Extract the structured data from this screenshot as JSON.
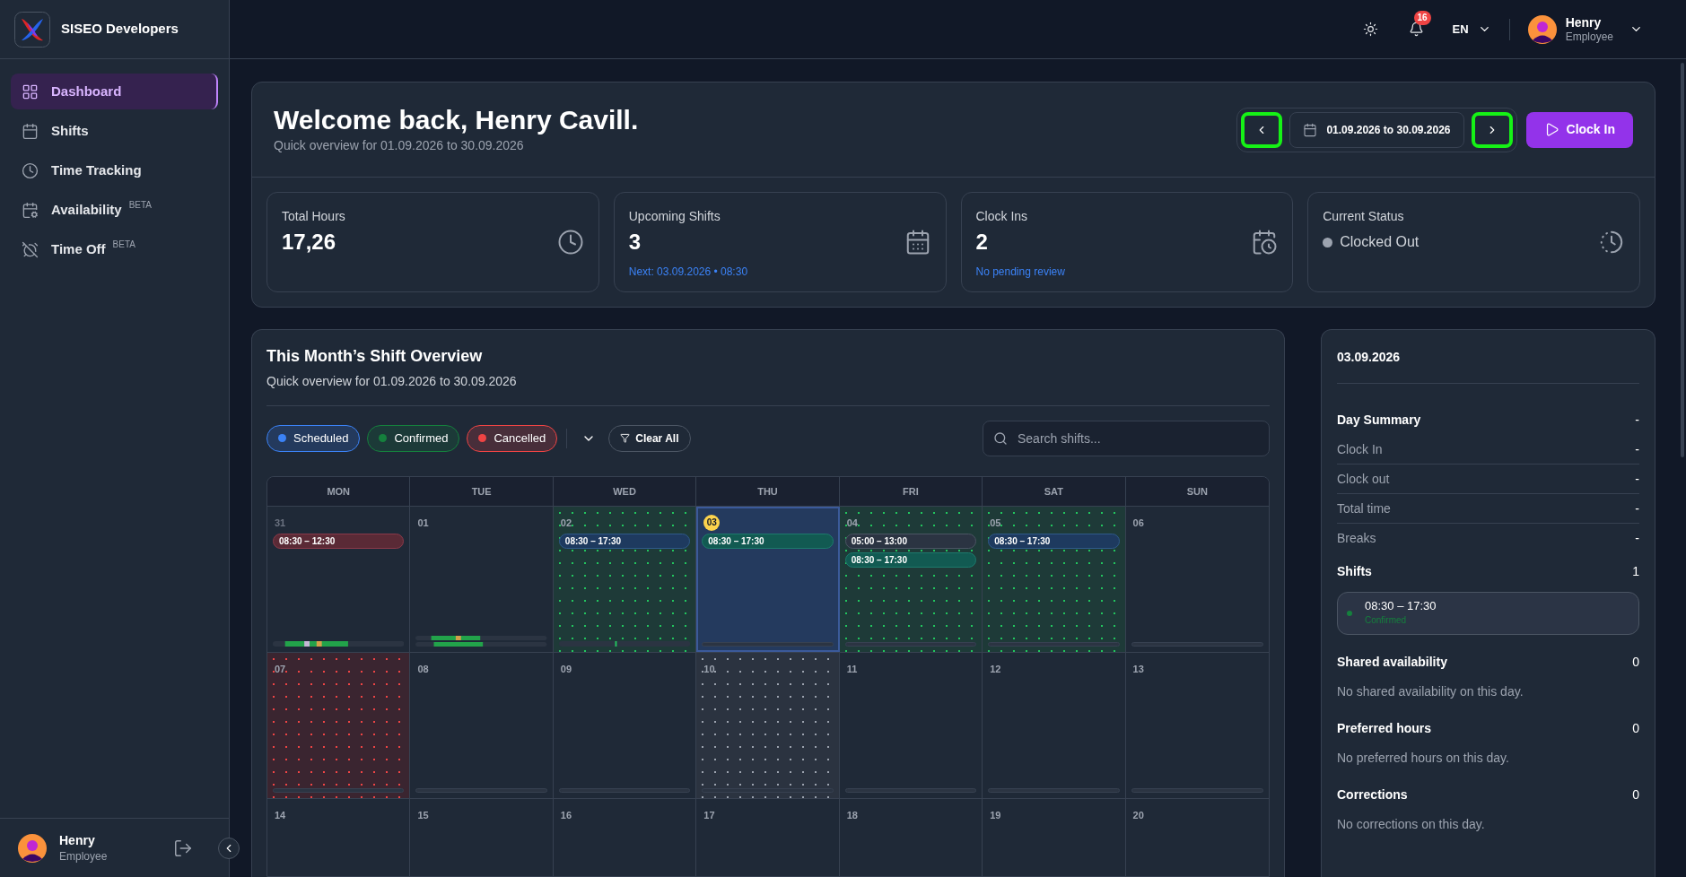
{
  "sidebar": {
    "brand": "SISEO Developers",
    "items": [
      {
        "label": "Dashboard",
        "selected": true
      },
      {
        "label": "Shifts",
        "selected": false
      },
      {
        "label": "Time Tracking",
        "selected": false
      },
      {
        "label": "Availability",
        "badge": "BETA",
        "selected": false
      },
      {
        "label": "Time Off",
        "badge": "BETA",
        "selected": false
      }
    ],
    "user": {
      "name": "Henry",
      "role": "Employee"
    }
  },
  "topbar": {
    "notifications": "16",
    "language": "EN",
    "user": {
      "name": "Henry",
      "role": "Employee"
    }
  },
  "welcome": {
    "title": "Welcome back, Henry Cavill.",
    "subtitle": "Quick overview for 01.09.2026 to 30.09.2026",
    "range": "01.09.2026 to 30.09.2026",
    "prev_highlighted": true,
    "next_highlighted": true,
    "clock_in": "Clock In"
  },
  "stats": [
    {
      "label": "Total Hours",
      "value": "17,26",
      "kind": "number"
    },
    {
      "label": "Upcoming Shifts",
      "value": "3",
      "note": "Next: 03.09.2026 • 08:30",
      "kind": "number"
    },
    {
      "label": "Clock Ins",
      "value": "2",
      "note": "No pending review",
      "kind": "number"
    },
    {
      "label": "Current Status",
      "value": "Clocked Out",
      "kind": "status"
    }
  ],
  "overview": {
    "title": "This Month’s Shift Overview",
    "subtitle": "Quick overview for 01.09.2026 to 30.09.2026",
    "filters": [
      {
        "label": "Scheduled",
        "color": "#3b82f6",
        "selected": true
      },
      {
        "label": "Confirmed",
        "color": "#15803d",
        "selected": true
      },
      {
        "label": "Cancelled",
        "color": "#ef4444",
        "selected": true
      }
    ],
    "clear": "Clear All",
    "search_placeholder": "Search shifts...",
    "weekdays": [
      "MON",
      "TUE",
      "WED",
      "THU",
      "FRI",
      "SAT",
      "SUN"
    ],
    "weeks": [
      [
        {
          "day": "31",
          "muted": true,
          "today": false,
          "selected": false,
          "shifts": [
            {
              "time": "08:30 – 12:30",
              "kind": "cancelled"
            }
          ]
        },
        {
          "day": "01",
          "muted": false,
          "today": false,
          "selected": false
        },
        {
          "day": "02",
          "kind": "confirmed",
          "muted": false,
          "today": false,
          "selected": false,
          "shifts": [
            {
              "time": "08:30 – 17:30",
              "kind": "scheduled"
            }
          ]
        },
        {
          "day": "03",
          "muted": false,
          "today": true,
          "selected": true,
          "shifts": [
            {
              "time": "08:30 – 17:30",
              "kind": "confirmed"
            }
          ]
        },
        {
          "day": "04",
          "kind": "confirmed",
          "muted": false,
          "today": false,
          "selected": false,
          "shifts": [
            {
              "time": "05:00 – 13:00",
              "kind": "neutral"
            },
            {
              "time": "08:30 – 17:30",
              "kind": "confirmed"
            }
          ]
        },
        {
          "day": "05",
          "kind": "confirmed",
          "muted": false,
          "today": false,
          "selected": false,
          "shifts": [
            {
              "time": "08:30 – 17:30",
              "kind": "scheduled"
            }
          ]
        },
        {
          "day": "06",
          "muted": false,
          "today": false,
          "selected": false
        }
      ],
      [
        {
          "day": "07",
          "kind": "cancelled",
          "muted": false,
          "today": false,
          "selected": false
        },
        {
          "day": "08",
          "muted": false,
          "today": false,
          "selected": false
        },
        {
          "day": "09",
          "muted": false,
          "today": false,
          "selected": false
        },
        {
          "day": "10",
          "kind": "neutral",
          "muted": false,
          "today": false,
          "selected": false
        },
        {
          "day": "11",
          "muted": false,
          "today": false,
          "selected": false
        },
        {
          "day": "12",
          "muted": false,
          "today": false,
          "selected": false
        },
        {
          "day": "13",
          "muted": false,
          "today": false,
          "selected": false
        }
      ],
      [
        {
          "day": "14",
          "muted": false,
          "today": false,
          "selected": false
        },
        {
          "day": "15",
          "muted": false,
          "today": false,
          "selected": false
        },
        {
          "day": "16",
          "muted": false,
          "today": false,
          "selected": false
        },
        {
          "day": "17",
          "muted": false,
          "today": false,
          "selected": false
        },
        {
          "day": "18",
          "muted": false,
          "today": false,
          "selected": false
        },
        {
          "day": "19",
          "muted": false,
          "today": false,
          "selected": false
        },
        {
          "day": "20",
          "muted": false,
          "today": false,
          "selected": false
        }
      ]
    ]
  },
  "day_panel": {
    "date": "03.09.2026",
    "summary": {
      "title": "Day Summary",
      "value": "-",
      "rows": [
        {
          "label": "Clock In",
          "value": "-"
        },
        {
          "label": "Clock out",
          "value": "-"
        },
        {
          "label": "Total time",
          "value": "-"
        },
        {
          "label": "Breaks",
          "value": "-"
        }
      ]
    },
    "shifts": {
      "title": "Shifts",
      "count": "1",
      "items": [
        {
          "time": "08:30 – 17:30",
          "status": "Confirmed",
          "color": "#15803d"
        }
      ]
    },
    "sections": [
      {
        "title": "Shared availability",
        "count": "0",
        "empty": "No shared availability on this day."
      },
      {
        "title": "Preferred hours",
        "count": "0",
        "empty": "No preferred hours on this day."
      },
      {
        "title": "Corrections",
        "count": "0",
        "empty": "No corrections on this day."
      }
    ]
  }
}
